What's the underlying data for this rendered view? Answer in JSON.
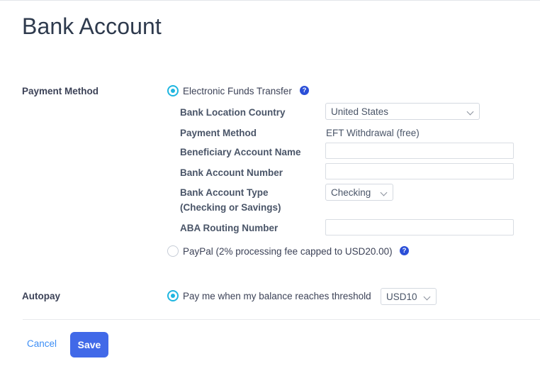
{
  "page": {
    "title": "Bank Account"
  },
  "payment_method_section": {
    "label": "Payment Method",
    "options": [
      {
        "id": "eft",
        "label": "Electronic Funds Transfer",
        "selected": true,
        "help_icon": "help-circle-icon",
        "help_glyph": "?"
      },
      {
        "id": "paypal",
        "label": "PayPal (2% processing fee capped to USD20.00)",
        "selected": false,
        "help_icon": "help-circle-icon",
        "help_glyph": "?"
      }
    ],
    "fields": {
      "bank_location_country": {
        "label": "Bank Location Country",
        "value": "United States",
        "chevron_icon": "chevron-down-icon"
      },
      "payment_method": {
        "label": "Payment Method",
        "value": "EFT Withdrawal (free)"
      },
      "beneficiary_account_name": {
        "label": "Beneficiary Account Name",
        "value": "",
        "placeholder": ""
      },
      "bank_account_number": {
        "label": "Bank Account Number",
        "value": "",
        "placeholder": ""
      },
      "bank_account_type": {
        "label_line1": "Bank Account Type",
        "label_line2": "(Checking or Savings)",
        "value": "Checking",
        "chevron_icon": "chevron-down-icon"
      },
      "aba_routing_number": {
        "label": "ABA Routing Number",
        "value": "",
        "placeholder": ""
      }
    }
  },
  "autopay_section": {
    "label": "Autopay",
    "option": {
      "label": "Pay me when my balance reaches threshold",
      "selected": true
    },
    "threshold": {
      "value": "USD10",
      "chevron_icon": "chevron-down-icon"
    }
  },
  "footer": {
    "cancel_label": "Cancel",
    "save_label": "Save"
  },
  "colors": {
    "accent_radio": "#1fb6e0",
    "help_blue": "#2b4fd8",
    "save_blue": "#4169e8",
    "link_blue": "#3d8ef5",
    "title": "#2e3a4d"
  }
}
